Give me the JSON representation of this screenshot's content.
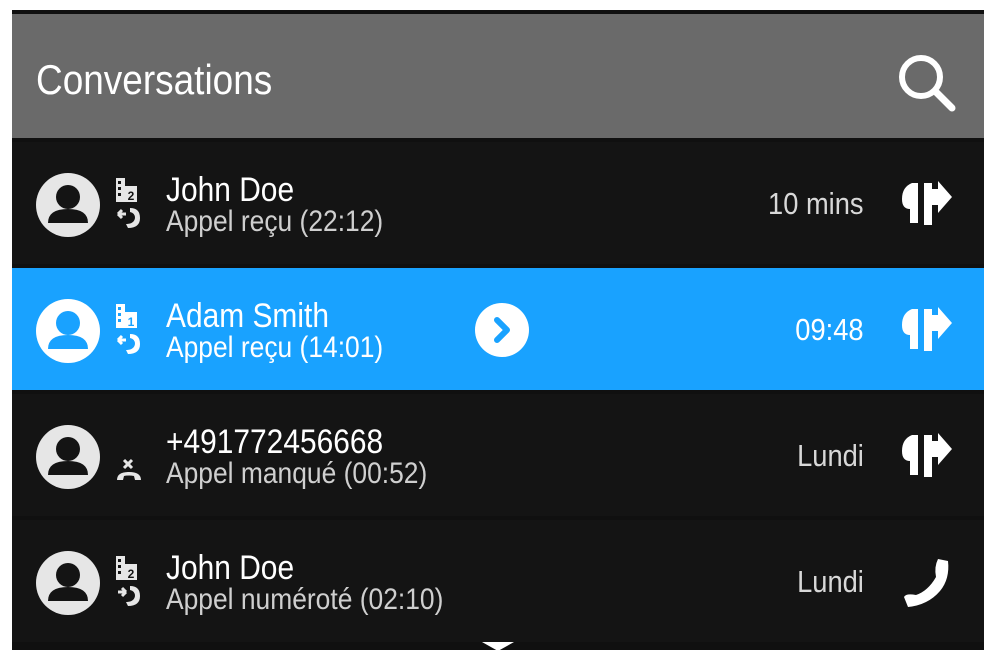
{
  "header": {
    "title": "Conversations",
    "search_icon": "search-icon"
  },
  "colors": {
    "header_bg": "#6a6a6a",
    "row_bg": "#141414",
    "selected_bg": "#19a2ff",
    "text": "#ffffff"
  },
  "conversations": [
    {
      "name": "John Doe",
      "status": "Appel reçu (22:12)",
      "time": "10 mins",
      "line": "line-2-icon",
      "call_type": "incoming-call-icon",
      "action": "transfer-icon",
      "selected": false
    },
    {
      "name": "Adam Smith",
      "status": "Appel reçu (14:01)",
      "time": "09:48",
      "line": "line-1-icon",
      "call_type": "incoming-call-icon",
      "action": "transfer-icon",
      "selected": true
    },
    {
      "name": "+491772456668",
      "status": "Appel manqué (00:52)",
      "time": "Lundi",
      "line": "",
      "call_type": "missed-call-icon",
      "action": "transfer-icon",
      "selected": false
    },
    {
      "name": "John Doe",
      "status": "Appel numéroté (02:10)",
      "time": "Lundi",
      "line": "line-2-icon",
      "call_type": "outgoing-call-icon",
      "action": "phone-icon",
      "selected": false
    }
  ]
}
